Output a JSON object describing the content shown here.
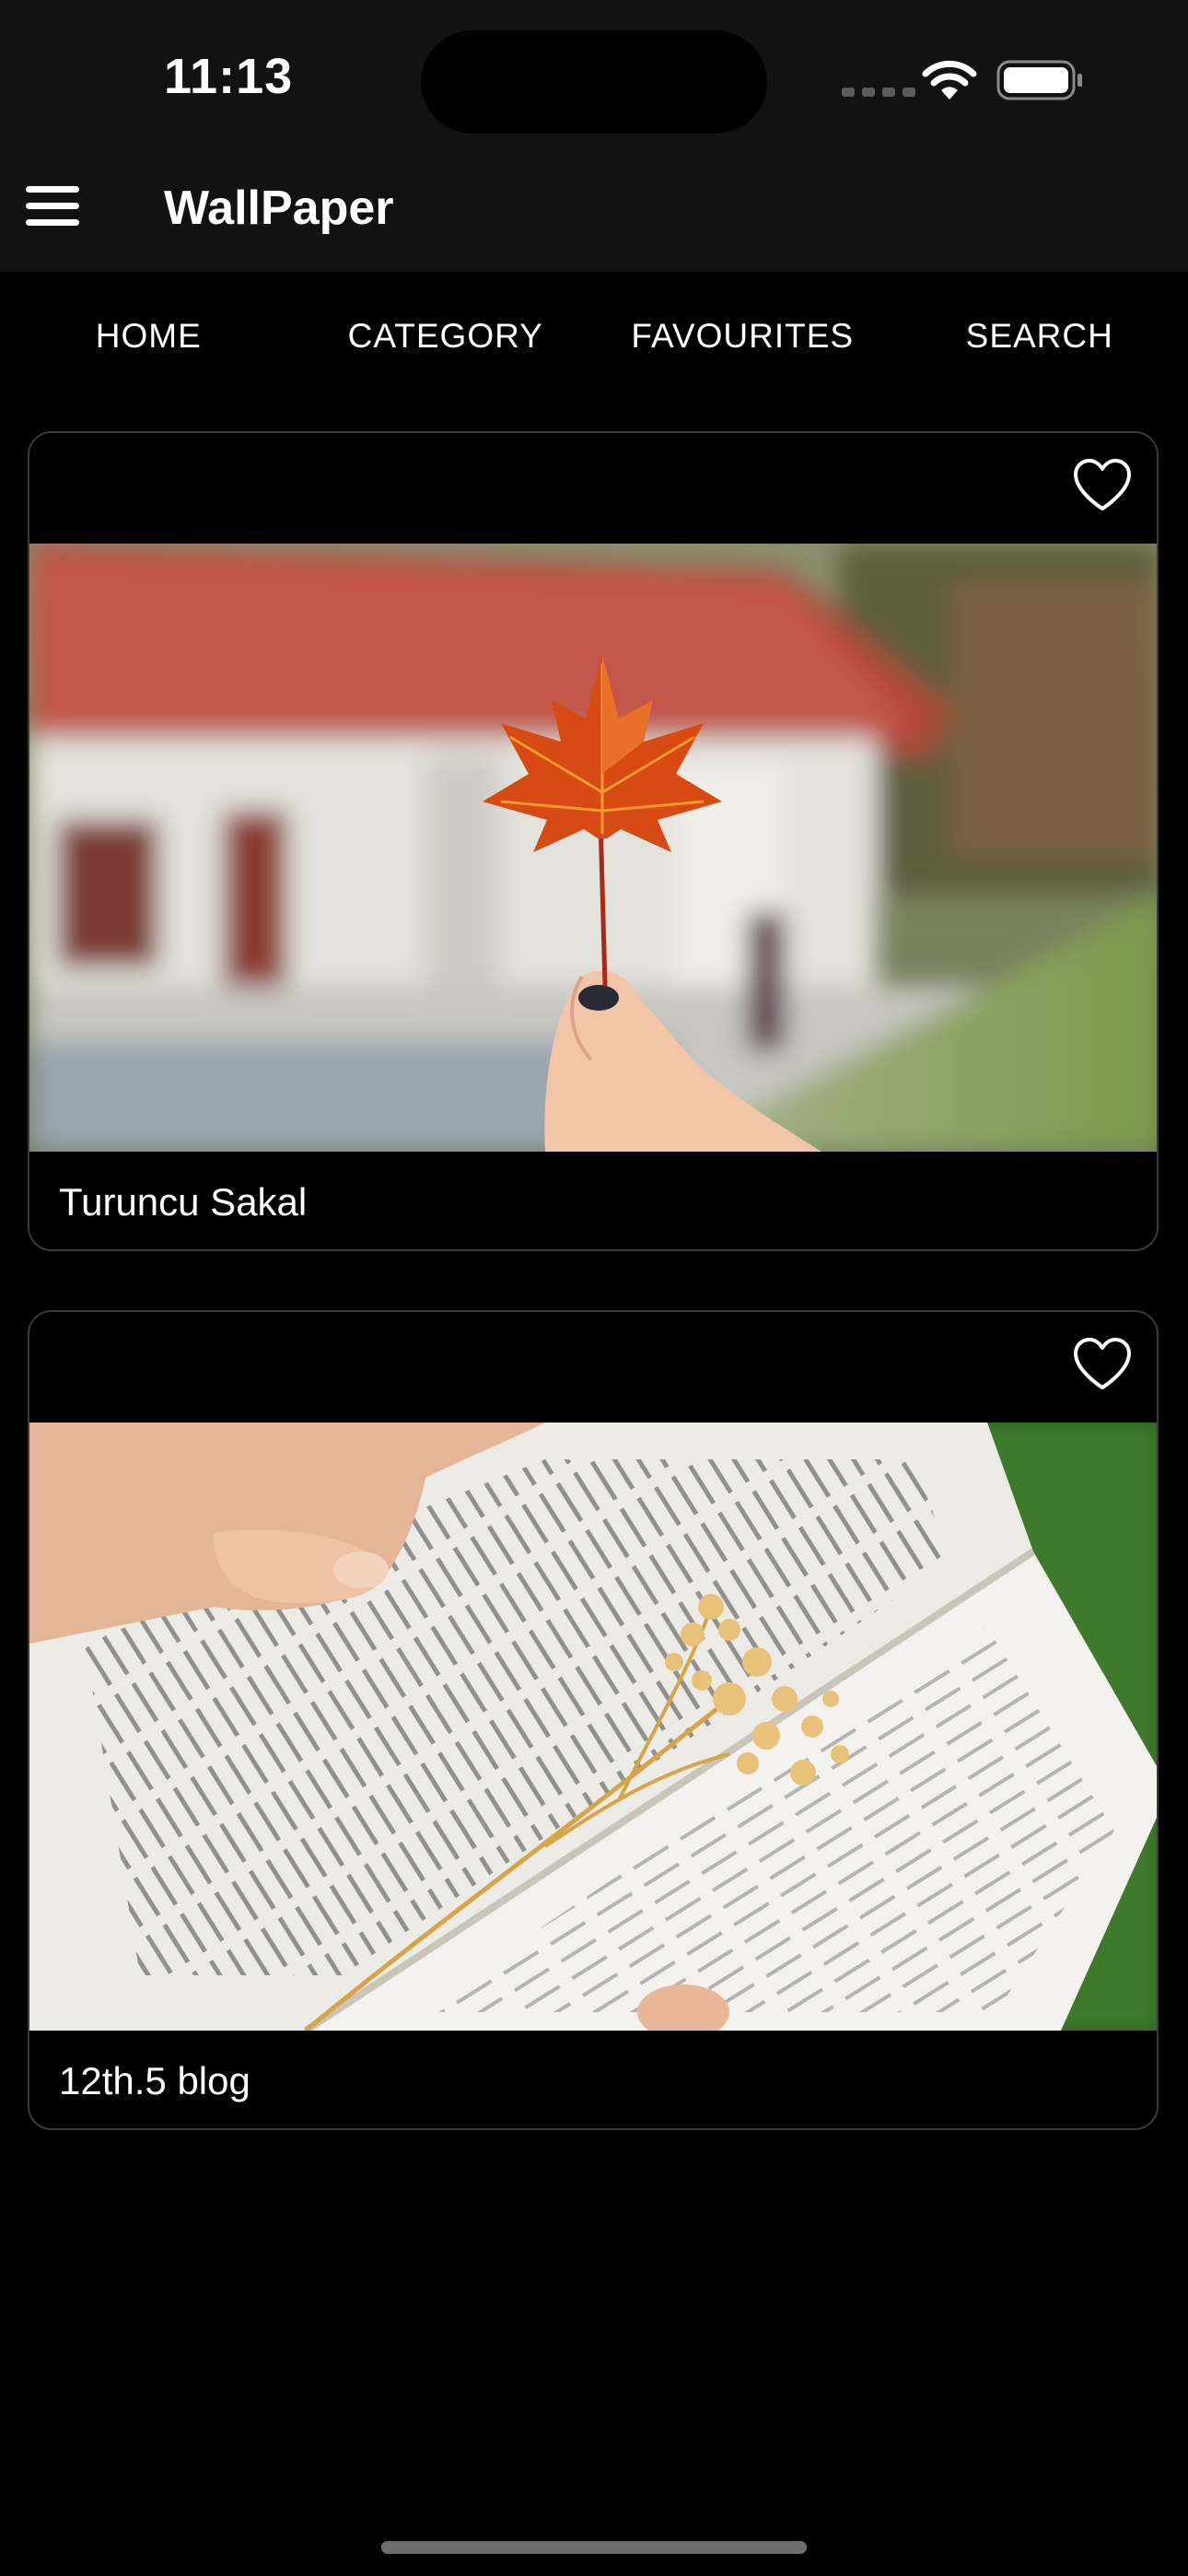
{
  "status_bar": {
    "time": "11:13"
  },
  "app_bar": {
    "menu_icon": "hamburger-menu-icon",
    "title": "WallPaper"
  },
  "tabs": [
    {
      "label": "HOME"
    },
    {
      "label": "CATEGORY"
    },
    {
      "label": "FAVOURITES"
    },
    {
      "label": "SEARCH"
    }
  ],
  "cards": [
    {
      "title": "Turuncu Sakal",
      "favorite_icon": "heart-outline-icon"
    },
    {
      "title": "12th.5 blog",
      "favorite_icon": "heart-outline-icon"
    }
  ],
  "colors": {
    "background": "#000000",
    "bar": "#121212",
    "card_border": "#3a3a3a",
    "text": "#ffffff"
  }
}
